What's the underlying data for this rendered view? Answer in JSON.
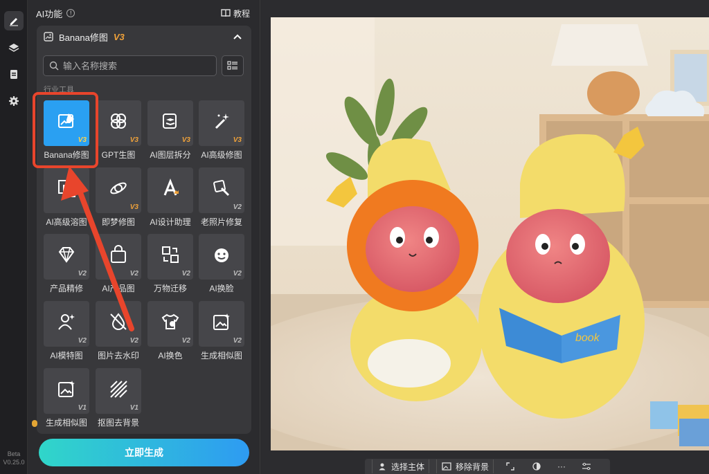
{
  "rail": {
    "items": [
      {
        "name": "edit",
        "icon": "pencil-icon",
        "active": true
      },
      {
        "name": "layers",
        "icon": "layers-icon",
        "active": false
      },
      {
        "name": "history",
        "icon": "clipboard-icon",
        "active": false
      },
      {
        "name": "settings",
        "icon": "gear-icon",
        "active": false
      }
    ],
    "beta_label": "Beta",
    "version_label": "V0.25.0"
  },
  "panel": {
    "title": "AI功能",
    "tutorial_label": "教程",
    "group": {
      "title": "Banana修图",
      "version_tag": "V3"
    },
    "search": {
      "placeholder": "输入名称搜索",
      "value": ""
    },
    "section_label": "行业工具",
    "tools": [
      {
        "label": "Banana修图",
        "ver": "V3",
        "gold": true,
        "active": true,
        "icon": "image-edit-icon"
      },
      {
        "label": "GPT生图",
        "ver": "V3",
        "gold": true,
        "active": false,
        "icon": "openai-knot-icon"
      },
      {
        "label": "AI图层拆分",
        "ver": "V3",
        "gold": true,
        "active": false,
        "icon": "layer-split-icon"
      },
      {
        "label": "AI高级修图",
        "ver": "V3",
        "gold": true,
        "active": false,
        "icon": "magic-wand-icon"
      },
      {
        "label": "AI高级溶图",
        "ver": "",
        "gold": false,
        "active": false,
        "icon": "image-blend-icon"
      },
      {
        "label": "即梦修图",
        "ver": "V3",
        "gold": true,
        "active": false,
        "icon": "planet-brush-icon"
      },
      {
        "label": "AI设计助理",
        "ver": "",
        "gold": false,
        "active": false,
        "icon": "letter-a-crown-icon"
      },
      {
        "label": "老照片修复",
        "ver": "V2",
        "gold": false,
        "active": false,
        "icon": "photo-repair-icon"
      },
      {
        "label": "产品精修",
        "ver": "V2",
        "gold": false,
        "active": false,
        "icon": "diamond-icon"
      },
      {
        "label": "AI产品图",
        "ver": "V2",
        "gold": false,
        "active": false,
        "icon": "shopping-bag-icon"
      },
      {
        "label": "万物迁移",
        "ver": "V2",
        "gold": false,
        "active": false,
        "icon": "transfer-icon"
      },
      {
        "label": "AI换脸",
        "ver": "V2",
        "gold": false,
        "active": false,
        "icon": "face-swap-icon"
      },
      {
        "label": "AI模特图",
        "ver": "V2",
        "gold": false,
        "active": false,
        "icon": "model-person-icon"
      },
      {
        "label": "图片去水印",
        "ver": "V2",
        "gold": false,
        "active": false,
        "icon": "watermark-remove-icon"
      },
      {
        "label": "AI换色",
        "ver": "V2",
        "gold": false,
        "active": false,
        "icon": "tshirt-color-icon"
      },
      {
        "label": "生成相似图",
        "ver": "V2",
        "gold": false,
        "active": false,
        "icon": "image-sparkle-icon"
      },
      {
        "label": "生成相似图",
        "ver": "V1",
        "gold": false,
        "active": false,
        "icon": "image-sparkle-icon"
      },
      {
        "label": "抠图去背景",
        "ver": "V1",
        "gold": false,
        "active": false,
        "icon": "cutout-stripes-icon"
      }
    ],
    "generate_label": "立即生成"
  },
  "canvas": {
    "image_description_icon": "photo-canvas",
    "book_text": "book",
    "toolbar": {
      "select_subject_label": "选择主体",
      "remove_bg_label": "移除背景",
      "more_label": "···"
    }
  },
  "colors": {
    "accent": "#2aa0f2",
    "annotation": "#e8452c",
    "version_gold": "#f0a23a",
    "generate_start": "#30d6c9",
    "generate_end": "#2e9bf2"
  }
}
